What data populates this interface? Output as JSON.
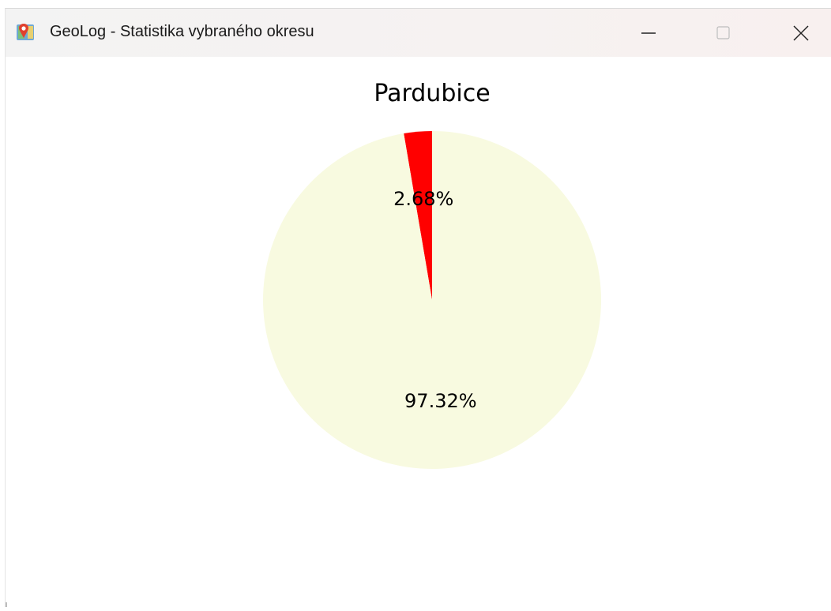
{
  "window": {
    "title": "GeoLog - Statistika vybraného okresu",
    "icon": "geolog-map-pin-icon",
    "controls": {
      "minimize_icon": "minimize-icon",
      "maximize_icon": "maximize-icon",
      "close_icon": "close-icon"
    }
  },
  "chart_data": {
    "type": "pie",
    "title": "Pardubice",
    "values": [
      2.68,
      97.32
    ],
    "labels": [
      "2.68%",
      "97.32%"
    ],
    "colors": [
      "#ff0000",
      "#f8fae0"
    ],
    "start_angle_deg": 90,
    "direction": "counterclockwise",
    "legend": false
  }
}
